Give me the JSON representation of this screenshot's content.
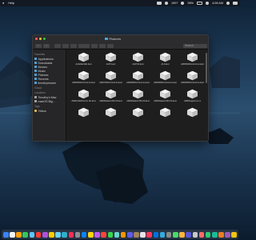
{
  "menubar": {
    "apple_icon": "apple-icon",
    "app_menu": "Help",
    "battery_percent": "55%",
    "clock": "4:08 AM",
    "mid_text": "1597",
    "extra_text": "100"
  },
  "window": {
    "title": "Pictures",
    "toolbar": {
      "back": "‹",
      "forward": "›",
      "search_placeholder": "Search"
    },
    "sidebar": {
      "favorites_header": "Favorites",
      "favorites": [
        {
          "label": "Applications",
          "icon": "applications-icon"
        },
        {
          "label": "Downloads",
          "icon": "downloads-icon"
        },
        {
          "label": "Movies",
          "icon": "movies-icon"
        },
        {
          "label": "Music",
          "icon": "music-icon"
        },
        {
          "label": "Pictures",
          "icon": "pictures-icon"
        },
        {
          "label": "Recents",
          "icon": "recents-icon"
        },
        {
          "label": "timothyemann",
          "icon": "home-icon"
        }
      ],
      "icloud_header": "iCloud",
      "locations_header": "Locations",
      "locations": [
        {
          "label": "Timothy's Mac",
          "icon": "computer-icon"
        },
        {
          "label": "macOS Big...",
          "icon": "disk-icon"
        }
      ],
      "tags_header": "Tags",
      "tags": [
        {
          "label": "Yellow",
          "color": "#f2c94c"
        }
      ]
    },
    "files": [
      {
        "label": "AAAMac32E.kext"
      },
      {
        "label": "ACPI.kext"
      },
      {
        "label": "AGPU0.kext"
      },
      {
        "label": "ALF.kext"
      },
      {
        "label": "AMD5000Control ler.kext"
      },
      {
        "label": "AMD6000Control ler.kext"
      },
      {
        "label": "AMD7000Control ler.kext"
      },
      {
        "label": "AMD8000Control ler.kext"
      },
      {
        "label": "AMD9000Control ler.kext"
      },
      {
        "label": "AMD9500Control ler.kext"
      },
      {
        "label": "AMD10000Contro ller.kext"
      },
      {
        "label": "AMDRadeonX40 00.kext"
      },
      {
        "label": "AMDRadeonX50 00.kext"
      },
      {
        "label": "AMDRadeonX60 00.kext"
      },
      {
        "label": "AMDSupport.ke xt"
      },
      {
        "label": ""
      },
      {
        "label": ""
      },
      {
        "label": ""
      },
      {
        "label": ""
      },
      {
        "label": ""
      }
    ]
  },
  "dock": {
    "colors": [
      "#3b82f6",
      "#f5f5f5",
      "#ff9f0a",
      "#34c759",
      "#5ac8fa",
      "#ff3b30",
      "#af52de",
      "#ffcc00",
      "#64d2ff",
      "#30b0c7",
      "#ff2d55",
      "#8e8e93",
      "#0a84ff",
      "#ffd60a",
      "#bf5af2",
      "#ff453a",
      "#32d74b",
      "#66d4cf",
      "#ff9500",
      "#5e5ce6",
      "#a2845e",
      "#e5e5ea",
      "#ff375f",
      "#0071e3",
      "#34aadc",
      "#8a8a8a",
      "#4cd964",
      "#ffb340",
      "#5856d6",
      "#c7c7cc",
      "#ff6b6b",
      "#2ecc71",
      "#1abc9c",
      "#e67e22",
      "#9b59b6",
      "#f1c40f"
    ]
  }
}
